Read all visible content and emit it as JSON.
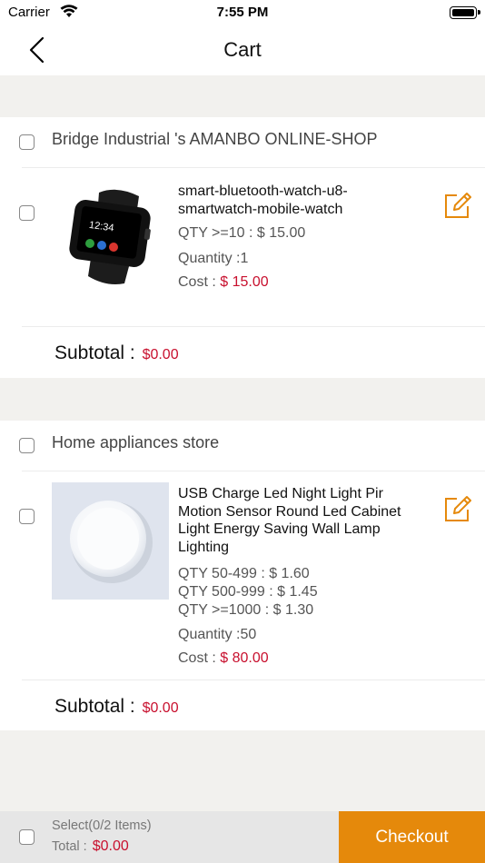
{
  "status_bar": {
    "carrier": "Carrier",
    "time": "7:55 PM"
  },
  "nav": {
    "title": "Cart"
  },
  "stores": [
    {
      "name": "Bridge Industrial 's AMANBO ONLINE-SHOP",
      "product": {
        "name": "smart-bluetooth-watch-u8-smartwatch-mobile-watch",
        "price_tiers": [
          "QTY >=10 : $ 15.00"
        ],
        "quantity": "Quantity :1",
        "cost_label": "Cost : ",
        "cost_value": "$ 15.00"
      },
      "subtotal_label": "Subtotal : ",
      "subtotal_value": "$0.00"
    },
    {
      "name": "Home appliances store",
      "product": {
        "name": "USB Charge Led Night Light Pir Motion Sensor Round Led Cabinet Light Energy Saving Wall Lamp Lighting",
        "price_tiers": [
          "QTY 50-499 : $ 1.60",
          "QTY 500-999 : $ 1.45",
          "QTY >=1000 : $ 1.30"
        ],
        "quantity": "Quantity :50",
        "cost_label": "Cost : ",
        "cost_value": "$ 80.00"
      },
      "subtotal_label": "Subtotal : ",
      "subtotal_value": "$0.00"
    }
  ],
  "bottom_bar": {
    "select_label": "Select(0/2 Items)",
    "total_label": "Total : ",
    "total_value": "$0.00",
    "checkout_label": "Checkout"
  },
  "colors": {
    "accent": "#e5890b",
    "price": "#c8102e"
  }
}
